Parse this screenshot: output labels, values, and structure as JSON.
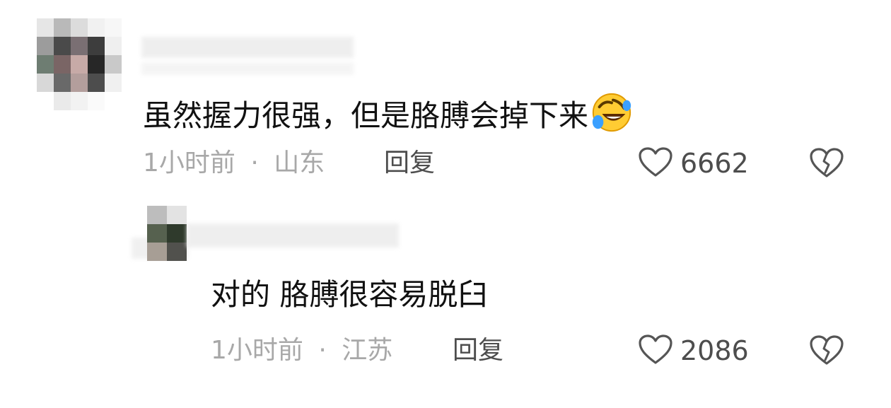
{
  "comments": [
    {
      "avatar_colors": [
        "#e6e6e6",
        "#b9b9b9",
        "#dcdcdc",
        "#f1f1f1",
        "#f7f7f7",
        "#9c9c9c",
        "#4a4a4a",
        "#7a6f73",
        "#3d3d3d",
        "#efefef",
        "#6e7d72",
        "#7a6565",
        "#c7aaa7",
        "#272727",
        "#c9c9c9",
        "#d8d8d8",
        "#696969",
        "#b39e9c",
        "#4d4d4d",
        "#f0f0f0",
        "#ffffff",
        "#eaeaea",
        "#f2f2f2",
        "#fafafa",
        "#ffffff"
      ],
      "text": "虽然握力很强，但是胳膊会掉下来",
      "emoji": "rolling-on-floor-laughing-emoji",
      "time": "1小时前",
      "separator": "·",
      "location": "山东",
      "reply_label": "回复",
      "like_count": "6662"
    },
    {
      "avatar_colors": [
        "#bdbdbd",
        "#e3e3e3",
        "#56614f",
        "#2f3a2c",
        "#a79e95",
        "#51514d"
      ],
      "text": "对的 胳膊很容易脱臼",
      "time": "1小时前",
      "separator": "·",
      "location": "江苏",
      "reply_label": "回复",
      "like_count": "2086"
    }
  ],
  "colors": {
    "text": "#111111",
    "meta": "#a8a8a8",
    "action": "#4d4d4d"
  }
}
